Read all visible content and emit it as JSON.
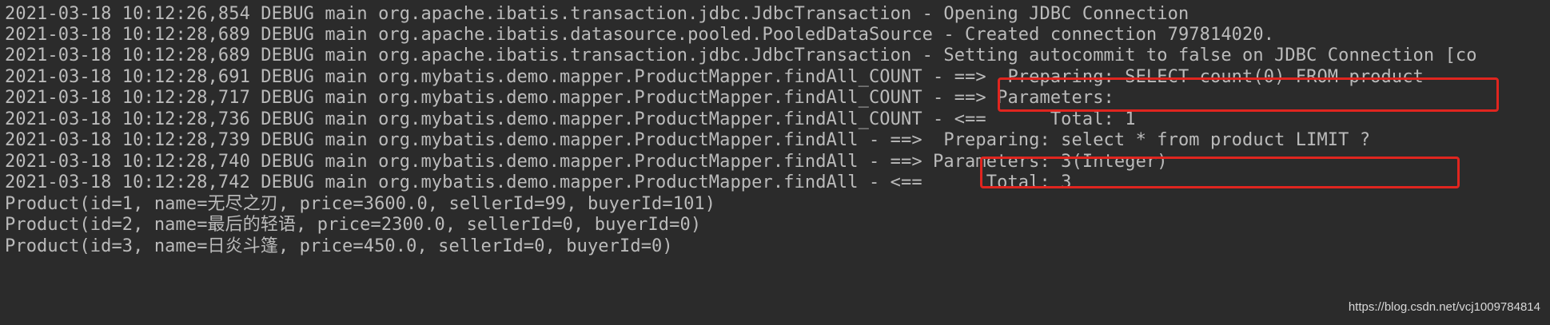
{
  "console": {
    "lines": [
      "2021-03-18 10:12:26,854 DEBUG main org.apache.ibatis.transaction.jdbc.JdbcTransaction - Opening JDBC Connection",
      "2021-03-18 10:12:28,689 DEBUG main org.apache.ibatis.datasource.pooled.PooledDataSource - Created connection 797814020.",
      "2021-03-18 10:12:28,689 DEBUG main org.apache.ibatis.transaction.jdbc.JdbcTransaction - Setting autocommit to false on JDBC Connection [co",
      "2021-03-18 10:12:28,691 DEBUG main org.mybatis.demo.mapper.ProductMapper.findAll_COUNT - ==>  Preparing: SELECT count(0) FROM product",
      "2021-03-18 10:12:28,717 DEBUG main org.mybatis.demo.mapper.ProductMapper.findAll_COUNT - ==> Parameters: ",
      "2021-03-18 10:12:28,736 DEBUG main org.mybatis.demo.mapper.ProductMapper.findAll_COUNT - <==      Total: 1",
      "2021-03-18 10:12:28,739 DEBUG main org.mybatis.demo.mapper.ProductMapper.findAll - ==>  Preparing: select * from product LIMIT ? ",
      "2021-03-18 10:12:28,740 DEBUG main org.mybatis.demo.mapper.ProductMapper.findAll - ==> Parameters: 3(Integer)",
      "2021-03-18 10:12:28,742 DEBUG main org.mybatis.demo.mapper.ProductMapper.findAll - <==      Total: 3",
      "Product(id=1, name=无尽之刃, price=3600.0, sellerId=99, buyerId=101)",
      "Product(id=2, name=最后的轻语, price=2300.0, sellerId=0, buyerId=0)",
      "Product(id=3, name=日炎斗篷, price=450.0, sellerId=0, buyerId=0)"
    ]
  },
  "watermark": "https://blog.csdn.net/vcj1009784814",
  "colors": {
    "background": "#2b2b2b",
    "text": "#bbbbbb",
    "highlight_border": "#e0251f"
  }
}
